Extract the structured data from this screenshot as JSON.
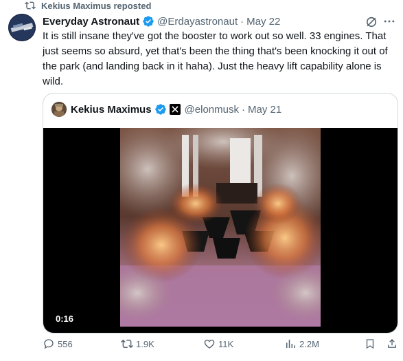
{
  "repost": {
    "text": "Kekius Maximus reposted",
    "icon": "repost-icon"
  },
  "tweet": {
    "author_name": "Everyday Astronaut",
    "handle": "@Erdayastronaut",
    "separator": "·",
    "date": "May 22",
    "text": "It is still insane they've got the booster to work out so well. 33 engines. That just seems so absurd, yet that's been the thing that's been knocking it out of the park (and landing back in it haha). Just the heavy lift capability alone is wild.",
    "grok_icon": "grok-icon",
    "more_icon": "more-icon"
  },
  "quote": {
    "author_name": "Kekius Maximus",
    "handle": "@elonmusk",
    "separator": "·",
    "date": "May 21",
    "video_time": "0:16"
  },
  "actions": {
    "replies": "556",
    "reposts": "1.9K",
    "likes": "11K",
    "views": "2.2M"
  },
  "colors": {
    "text": "#0f1419",
    "muted": "#536471",
    "verified": "#1d9bf0",
    "border": "#cfd9de"
  }
}
